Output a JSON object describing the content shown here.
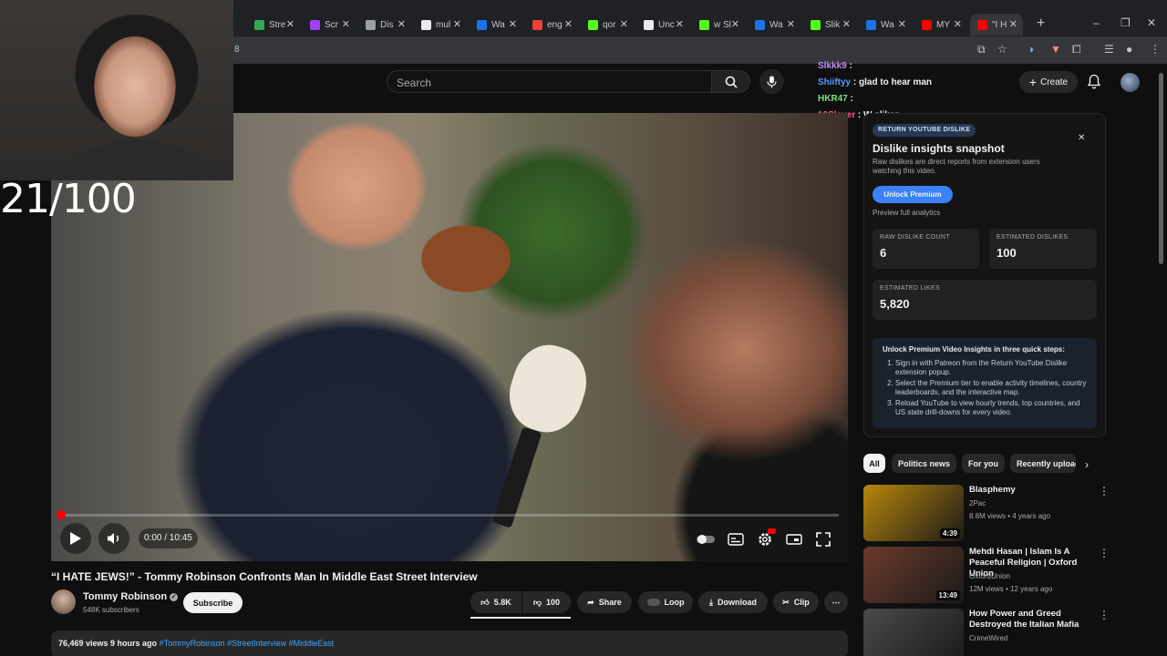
{
  "browser": {
    "tabs": [
      {
        "label": "Stre",
        "icon": "bar-chart-icon",
        "color": "#34a853"
      },
      {
        "label": "Scr",
        "icon": "pen-icon",
        "color": "#a142f4"
      },
      {
        "label": "Dis",
        "icon": "globe-icon",
        "color": "#9aa0a6"
      },
      {
        "label": "mul",
        "icon": "x-logo-icon",
        "color": "#e8eaed"
      },
      {
        "label": "Wa",
        "icon": "blue-circle-icon",
        "color": "#1a73e8"
      },
      {
        "label": "eng",
        "icon": "google-icon",
        "color": "#ea4335"
      },
      {
        "label": "qor",
        "icon": "k-logo-icon",
        "color": "#53fc18"
      },
      {
        "label": "Unc",
        "icon": "tiktok-icon",
        "color": "#e8eaed"
      },
      {
        "label": "w Sl",
        "icon": "k-logo-icon",
        "color": "#53fc18"
      },
      {
        "label": "Wa",
        "icon": "blue-circle-icon",
        "color": "#1a73e8"
      },
      {
        "label": "Slik",
        "icon": "k-logo-icon",
        "color": "#53fc18"
      },
      {
        "label": "Wa",
        "icon": "blue-circle-icon",
        "color": "#1a73e8"
      },
      {
        "label": "MY",
        "icon": "youtube-icon",
        "color": "#ff0000"
      },
      {
        "label": "\"I H",
        "icon": "youtube-icon",
        "color": "#ff0000",
        "active": true
      }
    ],
    "address_fragment": "8"
  },
  "youtube": {
    "search_placeholder": "Search",
    "create_label": "Create"
  },
  "chat": [
    {
      "user": "Slkkk9",
      "msg": "",
      "color": "#c58af9"
    },
    {
      "user": "Shiiftyy",
      "msg": "glad to hear man",
      "color": "#5b9cff"
    },
    {
      "user": "HKR47",
      "msg": "",
      "color": "#7be07b"
    },
    {
      "user": "10Slayer",
      "msg": "W sliker",
      "color": "#ff5c8a"
    }
  ],
  "overlay": {
    "counter": "21/100"
  },
  "player": {
    "time": "0:00 / 10:45",
    "progress": 0.0
  },
  "video": {
    "title": "“I HATE JEWS!” - Tommy Robinson Confronts Man In Middle East Street Interview",
    "channel": "Tommy Robinson",
    "subs": "548K subscribers",
    "subscribe_label": "Subscribe",
    "likes": "5.8K",
    "dislikes": "100",
    "share_label": "Share",
    "loop_label": "Loop",
    "download_label": "Download",
    "clip_label": "Clip",
    "views_line": "76,469 views  9 hours ago",
    "tags": "#TommyRobinson #StreetInterview #MiddleEast"
  },
  "dislike_panel": {
    "badge": "RETURN YOUTUBE DISLIKE",
    "heading": "Dislike insights snapshot",
    "subtext": "Raw dislikes are direct reports from extension users watching this video.",
    "unlock_label": "Unlock Premium",
    "preview_label": "Preview full analytics",
    "raw_label": "RAW DISLIKE COUNT",
    "raw_value": "6",
    "est_dislikes_label": "ESTIMATED DISLIKES",
    "est_dislikes_value": "100",
    "est_likes_label": "ESTIMATED LIKES",
    "est_likes_value": "5,820",
    "steps_heading": "Unlock Premium Video Insights in three quick steps:",
    "steps": [
      "Sign in with Patreon from the Return YouTube Dislike extension popup.",
      "Select the Premium tier to enable activity timelines, country leaderboards, and the interactive map.",
      "Reload YouTube to view hourly trends, top countries, and US state drill-downs for every video."
    ]
  },
  "chips": [
    "All",
    "Politics news",
    "For you",
    "Recently uploaded"
  ],
  "recommendations": [
    {
      "title": "Blasphemy",
      "channel": "2Pac",
      "meta": "8.8M views • 4 years ago",
      "duration": "4:39",
      "thumb_color": "#b8860b"
    },
    {
      "title": "Mehdi Hasan | Islam Is A Peaceful Religion | Oxford Union",
      "channel": "OxfordUnion",
      "meta": "12M views • 12 years ago",
      "duration": "13:49",
      "thumb_color": "#6b3a2a"
    },
    {
      "title": "How Power and Greed Destroyed the Italian Mafia",
      "channel": "CrimeWired",
      "meta": "",
      "duration": "",
      "thumb_color": "#4a4a4a"
    }
  ]
}
